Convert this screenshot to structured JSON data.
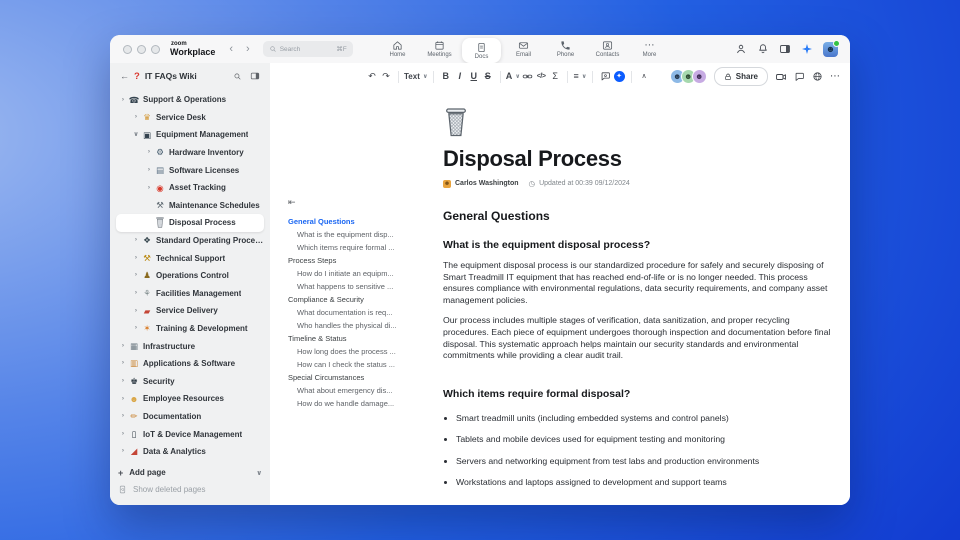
{
  "topbar": {
    "logo": {
      "top": "zoom",
      "bottom": "Workplace"
    },
    "search": {
      "placeholder": "Search",
      "shortcut": "⌘F"
    },
    "tabs": [
      {
        "label": "Home",
        "icon": "home-icon"
      },
      {
        "label": "Meetings",
        "icon": "calendar-icon"
      },
      {
        "label": "Docs",
        "icon": "doc-icon",
        "active": true
      },
      {
        "label": "Email",
        "icon": "envelope-icon"
      },
      {
        "label": "Phone",
        "icon": "phone-icon"
      },
      {
        "label": "Contacts",
        "icon": "contacts-icon"
      },
      {
        "label": "More",
        "icon": "more-icon"
      }
    ]
  },
  "sidebar": {
    "back": "←",
    "badge": "?",
    "title": "IT FAQs Wiki",
    "items": [
      {
        "label": "Support & Operations",
        "level": 1,
        "chevron": "right",
        "icon": "phone-icon",
        "glyph": "☎",
        "color": "#33424e"
      },
      {
        "label": "Service Desk",
        "level": 2,
        "chevron": "right",
        "icon": "service-desk-icon",
        "glyph": "♛",
        "color": "#d49a3a"
      },
      {
        "label": "Equipment Management",
        "level": 2,
        "chevron": "down",
        "icon": "monitor-icon",
        "glyph": "▣",
        "color": "#33424e"
      },
      {
        "label": "Hardware Inventory",
        "level": 3,
        "chevron": "right",
        "icon": "gear-icon",
        "glyph": "⚙",
        "color": "#3e5668"
      },
      {
        "label": "Software Licenses",
        "level": 3,
        "chevron": "right",
        "icon": "disk-icon",
        "glyph": "▤",
        "color": "#5e7285"
      },
      {
        "label": "Asset Tracking",
        "level": 3,
        "chevron": "right",
        "icon": "pin-icon",
        "glyph": "◉",
        "color": "#d8382a"
      },
      {
        "label": "Maintenance Schedules",
        "level": 3,
        "chevron": "",
        "icon": "tools-icon",
        "glyph": "⚒",
        "color": "#5f6a72"
      },
      {
        "label": "Disposal Process",
        "level": 3,
        "chevron": "",
        "icon": "trash-icon",
        "selected": true
      },
      {
        "label": "Standard Operating Procedures",
        "level": 2,
        "chevron": "right",
        "icon": "procedures-icon",
        "glyph": "❖",
        "color": "#37474f"
      },
      {
        "label": "Technical Support",
        "level": 2,
        "chevron": "right",
        "icon": "toolbox-icon",
        "glyph": "⚒",
        "color": "#b8860b"
      },
      {
        "label": "Operations Control",
        "level": 2,
        "chevron": "right",
        "icon": "control-icon",
        "glyph": "♟",
        "color": "#8a6a1f"
      },
      {
        "label": "Facilities Management",
        "level": 2,
        "chevron": "right",
        "icon": "facilities-icon",
        "glyph": "⚘",
        "color": "#7e8b8c"
      },
      {
        "label": "Service Delivery",
        "level": 2,
        "chevron": "right",
        "icon": "truck-icon",
        "glyph": "▰",
        "color": "#c44536"
      },
      {
        "label": "Training & Development",
        "level": 2,
        "chevron": "right",
        "icon": "training-icon",
        "glyph": "✶",
        "color": "#d97e2b"
      },
      {
        "label": "Infrastructure",
        "level": 1,
        "chevron": "right",
        "icon": "building-icon",
        "glyph": "▦",
        "color": "#6e7b84"
      },
      {
        "label": "Applications & Software",
        "level": 1,
        "chevron": "right",
        "icon": "laptop-icon",
        "glyph": "▥",
        "color": "#c9822f"
      },
      {
        "label": "Security",
        "level": 1,
        "chevron": "right",
        "icon": "guard-icon",
        "glyph": "♚",
        "color": "#2f3b45"
      },
      {
        "label": "Employee Resources",
        "level": 1,
        "chevron": "right",
        "icon": "person-icon",
        "glyph": "☻",
        "color": "#d9a441"
      },
      {
        "label": "Documentation",
        "level": 1,
        "chevron": "right",
        "icon": "pencil-icon",
        "glyph": "✏",
        "color": "#c9822f"
      },
      {
        "label": "IoT & Device Management",
        "level": 1,
        "chevron": "right",
        "icon": "device-icon",
        "glyph": "▯",
        "color": "#2f3b45"
      },
      {
        "label": "Data & Analytics",
        "level": 1,
        "chevron": "right",
        "icon": "chart-icon",
        "glyph": "◢",
        "color": "#c44536"
      }
    ],
    "add_page": "Add page",
    "show_deleted": "Show deleted pages"
  },
  "toc": {
    "items": [
      {
        "label": "General Questions",
        "type": "section",
        "active": true
      },
      {
        "label": "What is the equipment disp...",
        "type": "item"
      },
      {
        "label": "Which items require formal ...",
        "type": "item"
      },
      {
        "label": "Process Steps",
        "type": "section"
      },
      {
        "label": "How do I initiate an equipm...",
        "type": "item"
      },
      {
        "label": "What happens to sensitive ...",
        "type": "item"
      },
      {
        "label": "Compliance & Security",
        "type": "section"
      },
      {
        "label": "What documentation is req...",
        "type": "item"
      },
      {
        "label": "Who handles the physical di...",
        "type": "item"
      },
      {
        "label": "Timeline & Status",
        "type": "section"
      },
      {
        "label": "How long does the process ...",
        "type": "item"
      },
      {
        "label": "How can I check the status ...",
        "type": "item"
      },
      {
        "label": "Special Circumstances",
        "type": "section"
      },
      {
        "label": "What about emergency dis...",
        "type": "item"
      },
      {
        "label": "How do we handle damage...",
        "type": "item"
      }
    ]
  },
  "toolbar": {
    "text_style": "Text",
    "bold": "B",
    "italic": "I",
    "underline": "U",
    "strike": "S",
    "text_color": "A",
    "code": "</>",
    "equation": "Σ",
    "share_label": "Share"
  },
  "doc": {
    "title": "Disposal Process",
    "author": "Carlos Washington",
    "updated": "Updated at 00:39 09/12/2024",
    "section_heading": "General Questions",
    "question1": "What is the equipment disposal process?",
    "paragraph1": "The equipment disposal process is our standardized procedure for safely and securely disposing of Smart Treadmill IT equipment that has reached end-of-life or is no longer needed. This process ensures compliance with environmental regulations, data security requirements, and company asset management policies.",
    "paragraph2": "Our process includes multiple stages of verification, data sanitization, and proper recycling procedures. Each piece of equipment undergoes thorough inspection and documentation before final disposal. This systematic approach helps maintain our security standards and environmental commitments while providing a clear audit trail.",
    "question2": "Which items require formal disposal?",
    "bullets": [
      "Smart treadmill units (including embedded systems and control panels)",
      "Tablets and mobile devices used for equipment testing and monitoring",
      "Servers and networking equipment from test labs and production environments",
      "Workstations and laptops assigned to development and support teams"
    ]
  },
  "colors": {
    "accent_blue": "#0b5cff",
    "toc_active": "#1a66f2",
    "badge_red": "#d9372e"
  }
}
